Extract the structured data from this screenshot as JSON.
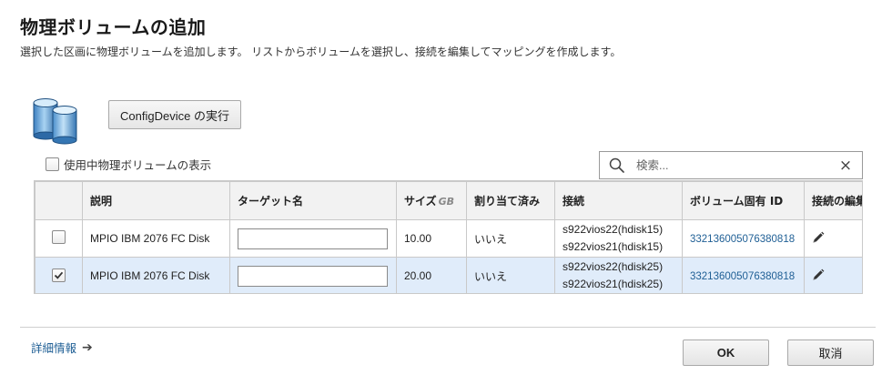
{
  "dialog": {
    "title": "物理ボリュームの追加",
    "description": "選択した区画に物理ボリュームを追加します。 リストからボリュームを選択し、接続を編集してマッピングを作成します。"
  },
  "toolbar": {
    "config_device_label": "ConfigDevice の実行",
    "show_in_use_label": "使用中物理ボリュームの表示",
    "show_in_use_checked": false
  },
  "search": {
    "placeholder": "検索...",
    "value": "",
    "icon": "search-icon",
    "clear_icon": "close-icon",
    "clear_glyph": "×"
  },
  "table": {
    "columns": {
      "description": "説明",
      "target_name": "ターゲット名",
      "size": "サイズ",
      "size_unit": "GB",
      "assigned": "割り当て済み",
      "connection": "接続",
      "volume_id": "ボリューム固有 ID",
      "edit_connection": "接続の編集"
    },
    "rows": [
      {
        "selected": false,
        "description": "MPIO IBM 2076 FC Disk",
        "target_name": "",
        "size": "10.00",
        "assigned": "いいえ",
        "connection_1": "s922vios22(hdisk15)",
        "connection_2": "s922vios21(hdisk15)",
        "volume_id": "332136005076380818"
      },
      {
        "selected": true,
        "description": "MPIO IBM 2076 FC Disk",
        "target_name": "",
        "size": "20.00",
        "assigned": "いいえ",
        "connection_1": "s922vios22(hdisk25)",
        "connection_2": "s922vios21(hdisk25)",
        "volume_id": "332136005076380818"
      }
    ]
  },
  "footer": {
    "details_link": "詳細情報",
    "details_arrow": "➔",
    "ok_label": "OK",
    "cancel_label": "取消"
  },
  "colors": {
    "link": "#1f5f95",
    "selected_row": "#e0ecfa",
    "header_bg": "#f2f2f2",
    "border": "#c9c9c9"
  }
}
